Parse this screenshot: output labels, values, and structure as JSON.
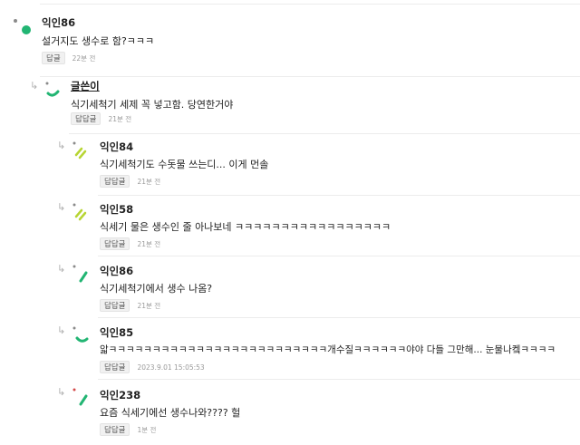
{
  "comments": [
    {
      "author": "익인86",
      "text": "설거지도 생수로 함?ㅋㅋㅋ",
      "reply_label": "답글",
      "time": "22분 전"
    },
    {
      "author": "글쓴이",
      "text": "식기세척기 세제 꼭 넣고함. 당연한거야",
      "reply_label": "답답글",
      "time": "21분 전"
    },
    {
      "author": "익인84",
      "text": "식기세척기도 수돗물 쓰는디... 이게 먼솔",
      "reply_label": "답답글",
      "time": "21분 전"
    },
    {
      "author": "익인58",
      "text": "식세기 물은 생수인 줄 아나보네 ㅋㅋㅋㅋㅋㅋㅋㅋㅋㅋㅋㅋㅋㅋㅋㅋㅋ",
      "reply_label": "답답글",
      "time": "21분 전"
    },
    {
      "author": "익인86",
      "text": "식기세척기에서 생수 나옴?",
      "reply_label": "답답글",
      "time": "21분 전"
    },
    {
      "author": "익인85",
      "text": "앏ㅋㅋㅋㅋㅋㅋㅋㅋㅋㅋㅋㅋㅋㅋㅋㅋㅋㅋㅋㅋㅋㅋㅋㅋㅋ개수질ㅋㅋㅋㅋㅋㅋ야야 다들 그만해... 눈물나켘ㅋㅋㅋㅋ",
      "reply_label": "답답글",
      "time": "2023.9.01 15:05:53"
    },
    {
      "author": "익인238",
      "text": "요즘 식세기에선 생수나와???? 헐",
      "reply_label": "답답글",
      "time": "1분 전"
    }
  ],
  "reply_arrow_glyph": "↳",
  "colors": {
    "accent_green": "#22b573",
    "lime": "#b7d533",
    "dot_gray": "#8a8a8a"
  }
}
